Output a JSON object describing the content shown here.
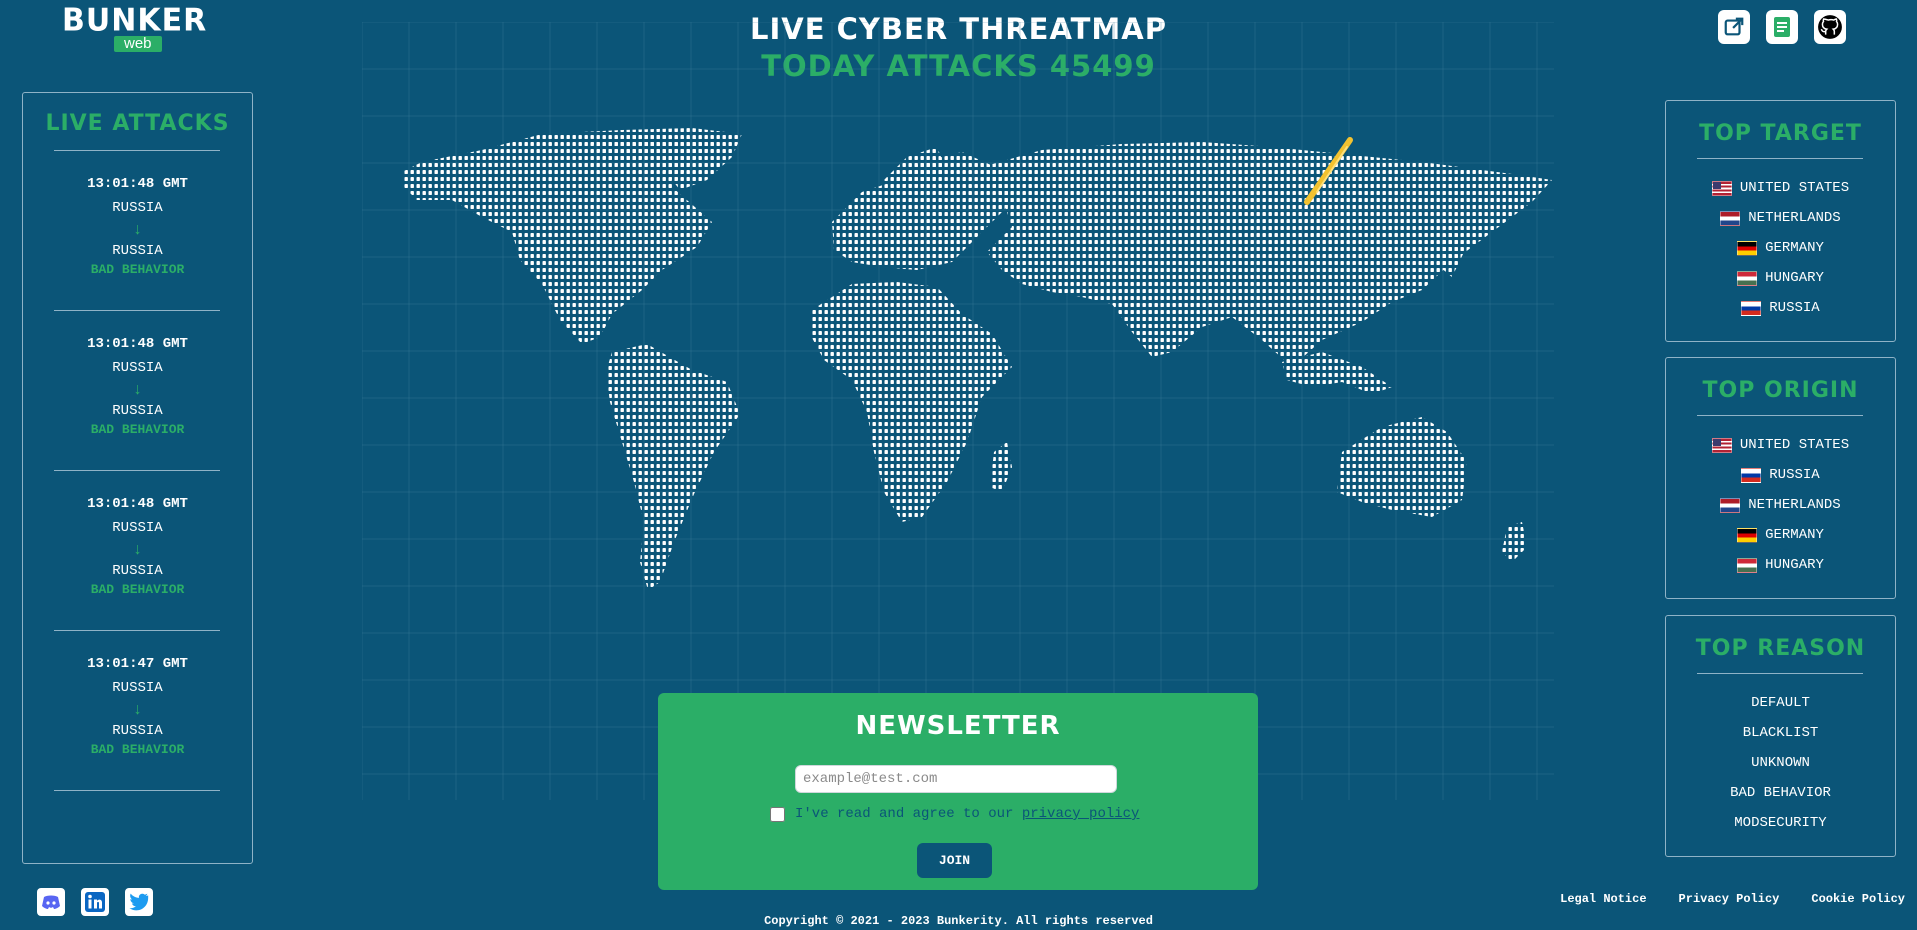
{
  "brand": {
    "logo_top": "BUNKER",
    "logo_sub": "web"
  },
  "header": {
    "title": "LIVE CYBER THREATMAP",
    "attacks_label": "TODAY ATTACKS 45499"
  },
  "top_icons": [
    {
      "icon": "external-link-icon"
    },
    {
      "icon": "docs-icon"
    },
    {
      "icon": "github-icon"
    }
  ],
  "colors": {
    "background": "#0b5578",
    "accent_green": "#2bae67",
    "attack_line": "#f2c230"
  },
  "live_attacks": {
    "title": "LIVE ATTACKS",
    "items": [
      {
        "time": "13:01:48 GMT",
        "from": "RUSSIA",
        "arrow": "↓",
        "to": "RUSSIA",
        "reason": "BAD BEHAVIOR"
      },
      {
        "time": "13:01:48 GMT",
        "from": "RUSSIA",
        "arrow": "↓",
        "to": "RUSSIA",
        "reason": "BAD BEHAVIOR"
      },
      {
        "time": "13:01:48 GMT",
        "from": "RUSSIA",
        "arrow": "↓",
        "to": "RUSSIA",
        "reason": "BAD BEHAVIOR"
      },
      {
        "time": "13:01:47 GMT",
        "from": "RUSSIA",
        "arrow": "↓",
        "to": "RUSSIA",
        "reason": "BAD BEHAVIOR"
      }
    ]
  },
  "top_target": {
    "title": "TOP TARGET",
    "items": [
      {
        "flag": "us",
        "country": "UNITED STATES"
      },
      {
        "flag": "nl",
        "country": "NETHERLANDS"
      },
      {
        "flag": "de",
        "country": "GERMANY"
      },
      {
        "flag": "hu",
        "country": "HUNGARY"
      },
      {
        "flag": "ru",
        "country": "RUSSIA"
      }
    ]
  },
  "top_origin": {
    "title": "TOP ORIGIN",
    "items": [
      {
        "flag": "us",
        "country": "UNITED STATES"
      },
      {
        "flag": "ru",
        "country": "RUSSIA"
      },
      {
        "flag": "nl",
        "country": "NETHERLANDS"
      },
      {
        "flag": "de",
        "country": "GERMANY"
      },
      {
        "flag": "hu",
        "country": "HUNGARY"
      }
    ]
  },
  "top_reason": {
    "title": "TOP REASON",
    "items": [
      "DEFAULT",
      "BLACKLIST",
      "UNKNOWN",
      "BAD BEHAVIOR",
      "MODSECURITY"
    ]
  },
  "newsletter": {
    "title": "NEWSLETTER",
    "email_placeholder": "example@test.com",
    "email_value": "",
    "consent_text": "I've read and agree to our",
    "consent_link": "privacy policy",
    "consent_checked": false,
    "join_label": "JOIN"
  },
  "socials": [
    {
      "icon": "discord-icon"
    },
    {
      "icon": "linkedin-icon"
    },
    {
      "icon": "twitter-icon"
    }
  ],
  "footer": {
    "copyright": "Copyright © 2021 - 2023 Bunkerity. All rights reserved",
    "links": [
      "Legal Notice",
      "Privacy Policy",
      "Cookie Policy"
    ]
  }
}
